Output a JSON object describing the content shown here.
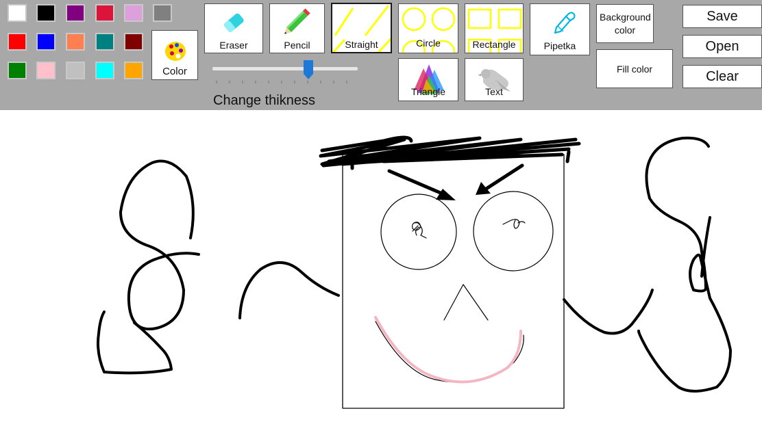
{
  "palette": {
    "colors": [
      "#ffffff",
      "#000000",
      "#800080",
      "#dc143c",
      "#dda0dd",
      "#808080",
      "#ff0000",
      "#0000ff",
      "#ff7f50",
      "#008080",
      "#800000",
      "#008000",
      "#ffc0cb",
      "#c0c0c0",
      "#00ffff",
      "#ffa500"
    ]
  },
  "color_button": {
    "label": "Color"
  },
  "tools": {
    "eraser": {
      "label": "Eraser"
    },
    "pencil": {
      "label": "Pencil"
    },
    "straight": {
      "label": "Straight",
      "selected": true
    },
    "circle": {
      "label": "Circle"
    },
    "rectangle": {
      "label": "Rectangle"
    },
    "pipetka": {
      "label": "Pipetka"
    },
    "triangle": {
      "label": "Triangle"
    },
    "text": {
      "label": "Text"
    }
  },
  "fill_buttons": {
    "background_color": "Background color",
    "fill_color": "Fill color"
  },
  "file_buttons": {
    "save": "Save",
    "open": "Open",
    "clear": "Clear"
  },
  "thickness": {
    "label": "Change thikness",
    "value_fraction": 0.67
  },
  "colors": {
    "toolbar_bg": "#a8a8a8",
    "slider_thumb": "#1e78d7",
    "stroke": "#000000",
    "mouth": "#f4b6c2",
    "tool_icon_yellow": "#ffff00"
  }
}
